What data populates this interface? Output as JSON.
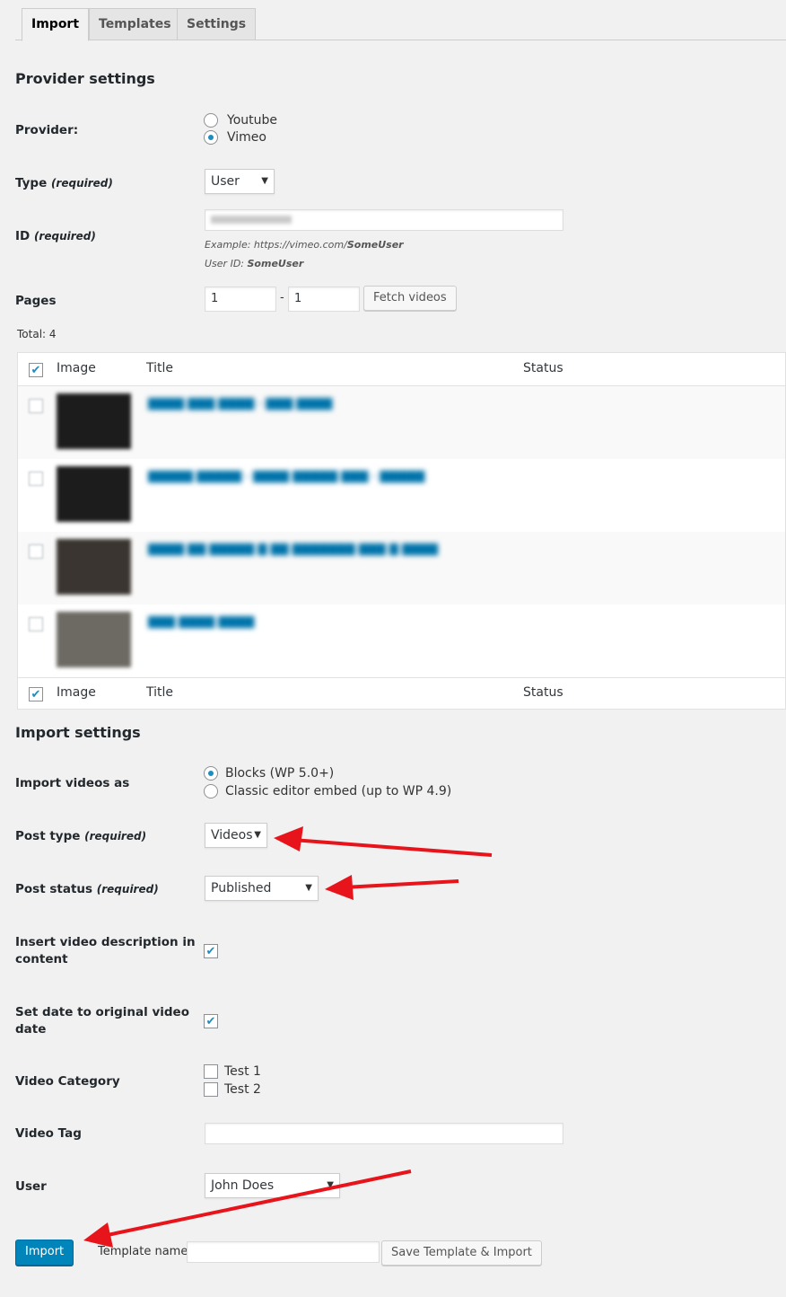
{
  "tabs": [
    {
      "label": "Import",
      "active": true
    },
    {
      "label": "Templates",
      "active": false
    },
    {
      "label": "Settings",
      "active": false
    }
  ],
  "provider_section": {
    "heading": "Provider settings",
    "provider_label": "Provider:",
    "provider_options": [
      {
        "label": "Youtube",
        "selected": false
      },
      {
        "label": "Vimeo",
        "selected": true
      }
    ],
    "type_label": "Type",
    "type_required": "(required)",
    "type_value": "User",
    "id_label": "ID",
    "id_required": "(required)",
    "id_example_prefix": "Example: https://vimeo.com/",
    "id_example_user": "SomeUser",
    "id_userid_prefix": "User ID: ",
    "id_userid_value": "SomeUser",
    "pages_label": "Pages",
    "pages_from": "1",
    "pages_separator": "-",
    "pages_to": "1",
    "fetch_button": "Fetch videos"
  },
  "results": {
    "total": "Total: 4",
    "columns": {
      "image": "Image",
      "title": "Title",
      "status": "Status"
    },
    "row_count": 4
  },
  "import_section": {
    "heading": "Import settings",
    "import_as_label": "Import videos as",
    "import_as_options": [
      {
        "label": "Blocks (WP 5.0+)",
        "selected": true
      },
      {
        "label": "Classic editor embed (up to WP 4.9)",
        "selected": false
      }
    ],
    "post_type_label": "Post type",
    "post_type_required": "(required)",
    "post_type_value": "Videos",
    "post_status_label": "Post status",
    "post_status_required": "(required)",
    "post_status_value": "Published",
    "insert_desc_label_1": "Insert video description in",
    "insert_desc_label_2": "content",
    "insert_desc_checked": true,
    "set_date_label_1": "Set date to original video",
    "set_date_label_2": "date",
    "set_date_checked": true,
    "category_label": "Video Category",
    "categories": [
      {
        "label": "Test 1",
        "checked": false
      },
      {
        "label": "Test 2",
        "checked": false
      }
    ],
    "tag_label": "Video Tag",
    "tag_value": "",
    "user_label": "User",
    "user_value": "John Does"
  },
  "footer": {
    "import_button": "Import",
    "template_name_label": "Template name:",
    "template_name_value": "",
    "save_template_button": "Save Template & Import"
  },
  "annotation_color": "#e8141b",
  "accent_color": "#0085ba"
}
